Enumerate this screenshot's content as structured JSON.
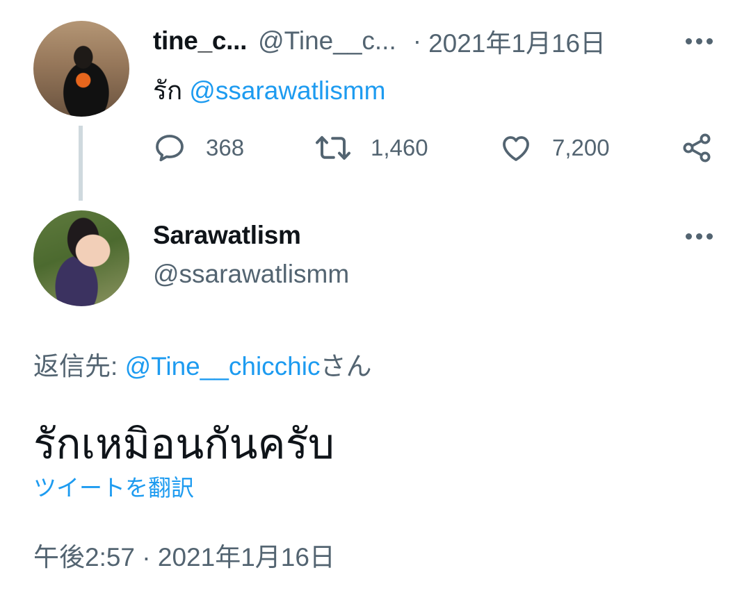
{
  "parent_tweet": {
    "display_name": "tine_c...",
    "handle": "@Tine__c...",
    "separator": "·",
    "date": "2021年1月16日",
    "text_prefix": "รัก",
    "text_mention": "@ssarawatlismm",
    "stats": {
      "replies": "368",
      "retweets": "1,460",
      "likes": "7,200"
    }
  },
  "reply_tweet": {
    "display_name": "Sarawatlism",
    "handle": "@ssarawatlismm",
    "replying_prefix": "返信先: ",
    "replying_mention": "@Tine__chicchic",
    "replying_suffix": "さん",
    "text": "รักเหมิอนกันครับ",
    "translate_label": "ツイートを翻訳",
    "timestamp": "午後2:57 · 2021年1月16日"
  },
  "icons": {
    "reply": "reply-icon",
    "retweet": "retweet-icon",
    "like": "heart-icon",
    "share": "share-icon",
    "more": "more-icon"
  },
  "colors": {
    "accent": "#1d9bf0",
    "muted": "#536471",
    "text": "#0f1419",
    "thread_line": "#cfd9de"
  }
}
